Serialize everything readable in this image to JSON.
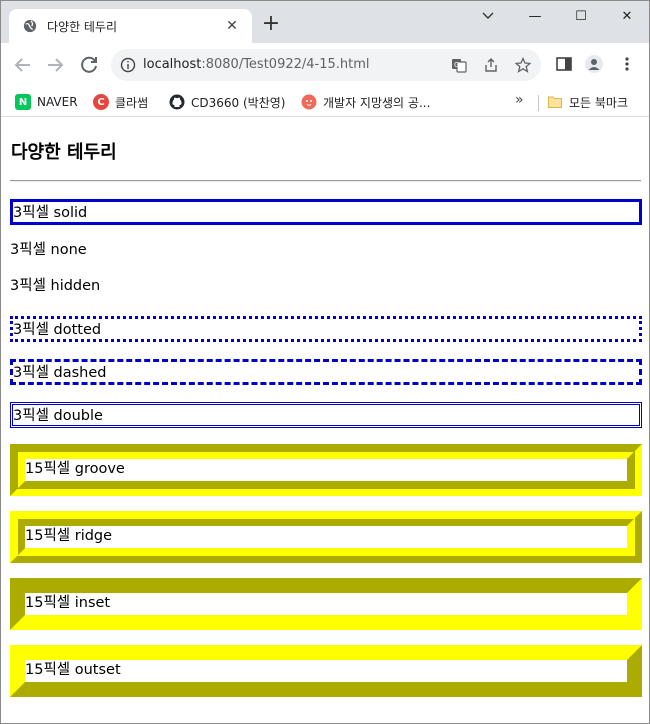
{
  "tab": {
    "title": "다양한 테두리",
    "close": "✕",
    "new_tab": "+"
  },
  "window_controls": {
    "minimize": "—",
    "maximize": "☐",
    "close": "✕"
  },
  "address": {
    "host": "localhost",
    "path": ":8080/Test0922/4-15.html"
  },
  "bookmarks": {
    "items": [
      {
        "label": "NAVER",
        "icon": "naver-icon",
        "color": "#03c75a",
        "glyph": "N"
      },
      {
        "label": "클라썸",
        "icon": "classum-icon",
        "color": "#e8453c",
        "glyph": "C"
      },
      {
        "label": "CD3660 (박찬영)",
        "icon": "github-icon",
        "color": "#24292f",
        "glyph": ""
      },
      {
        "label": "개발자 지망생의 공...",
        "icon": "blog-icon",
        "color": "#ef6a5a",
        "glyph": ""
      }
    ],
    "more": "»",
    "folder_label": "모든 북마크"
  },
  "page": {
    "heading": "다양한 테두리",
    "borders": {
      "solid": "3픽셀 solid",
      "none": "3픽셀 none",
      "hidden": "3픽셀 hidden",
      "dotted": "3픽셀 dotted",
      "dashed": "3픽셀 dashed",
      "double": "3픽셀 double",
      "groove": "15픽셀 groove",
      "ridge": "15픽셀 ridge",
      "inset": "15픽셀 inset",
      "outset": "15픽셀 outset"
    }
  },
  "colors": {
    "thin_border": "#0000cc",
    "thick_border": "#ffff00",
    "tab_strip": "#dee1e6"
  }
}
